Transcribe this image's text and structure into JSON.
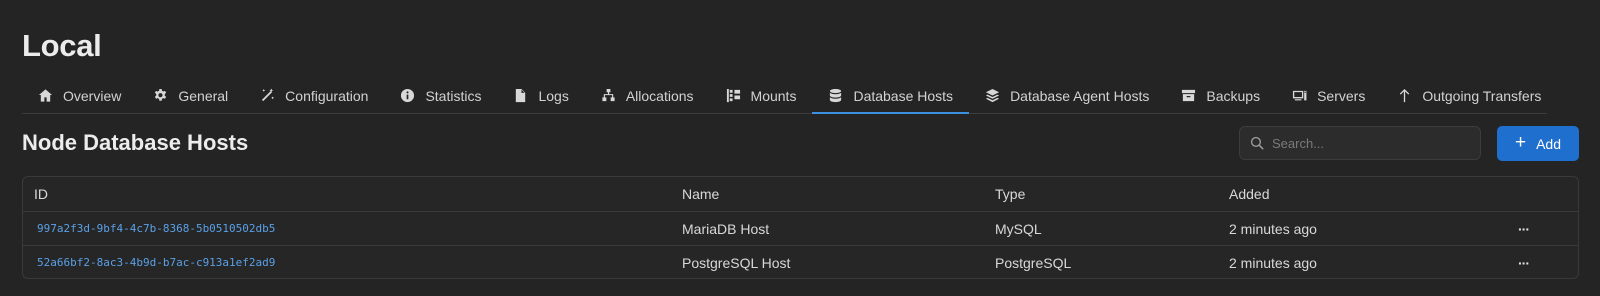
{
  "node": {
    "title": "Local"
  },
  "tabs": [
    {
      "label": "Overview",
      "icon": "home-icon"
    },
    {
      "label": "General",
      "icon": "gear-icon"
    },
    {
      "label": "Configuration",
      "icon": "wand-icon"
    },
    {
      "label": "Statistics",
      "icon": "info-icon"
    },
    {
      "label": "Logs",
      "icon": "file-icon"
    },
    {
      "label": "Allocations",
      "icon": "network-icon"
    },
    {
      "label": "Mounts",
      "icon": "mounts-icon"
    },
    {
      "label": "Database Hosts",
      "icon": "database-icon",
      "active": true
    },
    {
      "label": "Database Agent Hosts",
      "icon": "layers-icon"
    },
    {
      "label": "Backups",
      "icon": "archive-icon"
    },
    {
      "label": "Servers",
      "icon": "servers-icon"
    },
    {
      "label": "Outgoing Transfers",
      "icon": "arrow-up-icon"
    }
  ],
  "section": {
    "title": "Node Database Hosts"
  },
  "search": {
    "placeholder": "Search..."
  },
  "add_button": {
    "label": "Add"
  },
  "table": {
    "headers": {
      "id": "ID",
      "name": "Name",
      "type": "Type",
      "added": "Added"
    },
    "rows": [
      {
        "id": "997a2f3d-9bf4-4c7b-8368-5b0510502db5",
        "name": "MariaDB Host",
        "type": "MySQL",
        "added": "2 minutes ago",
        "menu": "···"
      },
      {
        "id": "52a66bf2-8ac3-4b9d-b7ac-c913a1ef2ad9",
        "name": "PostgreSQL Host",
        "type": "PostgreSQL",
        "added": "2 minutes ago",
        "menu": "···"
      }
    ]
  },
  "colors": {
    "accent": "#1f6fcf",
    "link": "#5aa0e6",
    "background": "#242424"
  }
}
